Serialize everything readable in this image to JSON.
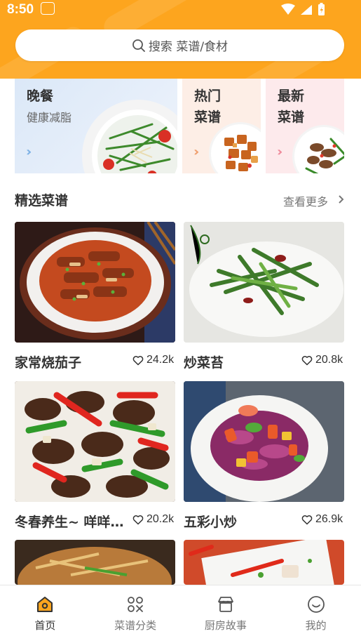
{
  "status_bar": {
    "time": "8:50"
  },
  "search": {
    "label": "搜索 菜谱/食材"
  },
  "categories": [
    {
      "title": "晚餐",
      "subtitle": "健康减脂"
    },
    {
      "title": "热门\n菜谱"
    },
    {
      "title": "最新\n菜谱"
    }
  ],
  "section": {
    "title": "精选菜谱",
    "more": "查看更多"
  },
  "recipes": [
    {
      "name": "家常烧茄子",
      "likes": "24.2k"
    },
    {
      "name": "炒菜苔",
      "likes": "20.8k"
    },
    {
      "name": "冬春养生~ 咩咩羊肉",
      "likes": "20.2k"
    },
    {
      "name": "五彩小炒",
      "likes": "26.9k"
    }
  ],
  "nav": [
    {
      "label": "首页",
      "icon": "home-icon",
      "active": true
    },
    {
      "label": "菜谱分类",
      "icon": "category-icon",
      "active": false
    },
    {
      "label": "厨房故事",
      "icon": "store-icon",
      "active": false
    },
    {
      "label": "我的",
      "icon": "smile-icon",
      "active": false
    }
  ],
  "colors": {
    "accent": "#FDA51E",
    "text": "#333333",
    "muted": "#777777"
  }
}
